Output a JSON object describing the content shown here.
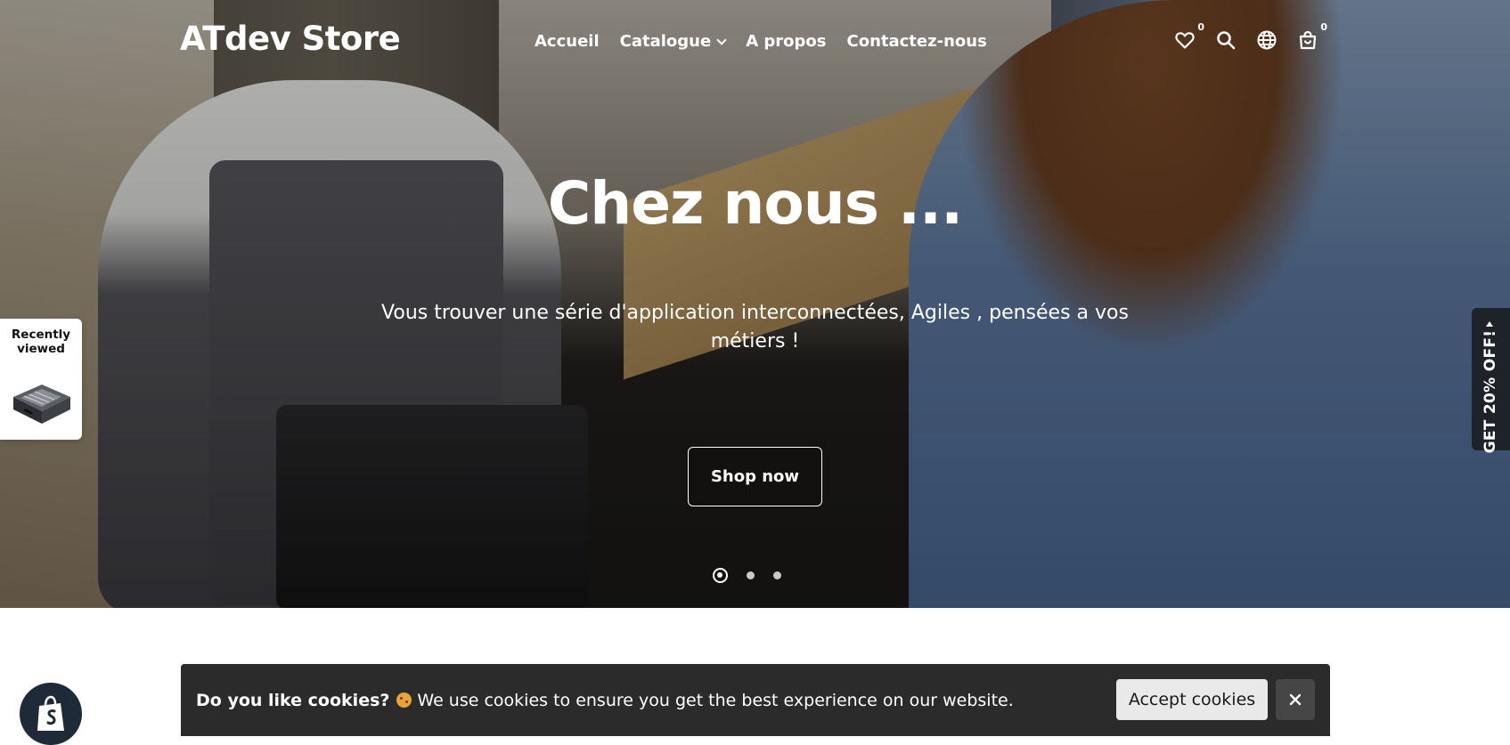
{
  "header": {
    "logo": "ATdev Store",
    "nav": [
      {
        "label": "Accueil"
      },
      {
        "label": "Catalogue",
        "has_dropdown": true
      },
      {
        "label": "A propos"
      },
      {
        "label": "Contactez-nous"
      }
    ],
    "wishlist_count": "0",
    "cart_count": "0",
    "icons": [
      "heart-icon",
      "search-icon",
      "globe-icon",
      "bag-icon"
    ]
  },
  "hero": {
    "title": "Chez nous ...",
    "subtitle": "Vous trouver une série d'application interconnectées, Agiles , pensées a vos métiers !",
    "button": "Shop now",
    "slides": 3,
    "active_slide": 1
  },
  "recently_viewed": {
    "label": "Recently viewed"
  },
  "promo_tab": {
    "label": "GET 20% OFF!"
  },
  "cookie_bar": {
    "title": "Do you like cookies?",
    "message": "We use cookies to ensure you get the best experience on our website.",
    "accept": "Accept cookies",
    "close_symbol": "✕"
  },
  "colors": {
    "cookie_bg": "#2b2b2b",
    "promo_bg": "#1e2329",
    "shopify_badge": "#1f2a38"
  }
}
